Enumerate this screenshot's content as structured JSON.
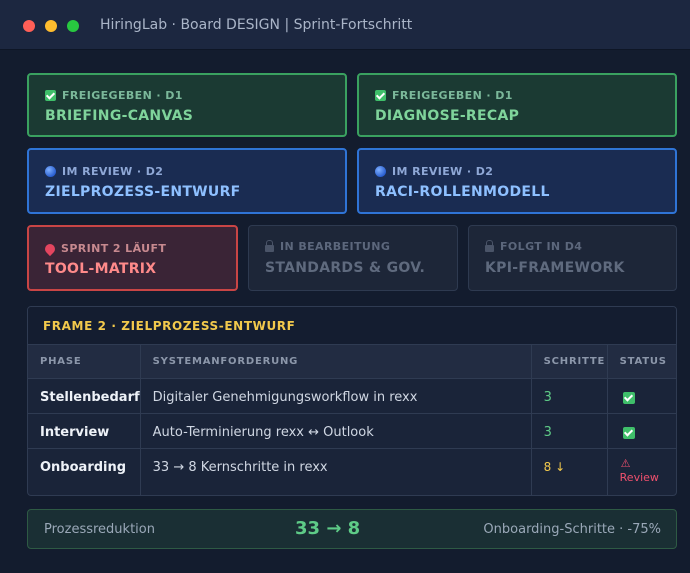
{
  "window": {
    "title": "HiringLab · Board DESIGN | Sprint-Fortschritt"
  },
  "colors": {
    "approved": "#3aa160",
    "review": "#2f74d6",
    "running": "#c94545",
    "locked": "#2e3a50",
    "accent": "#f2c94c"
  },
  "cards": [
    {
      "icon": "check-icon",
      "status": "FREIGEGEBEN · D1",
      "name": "BRIEFING-CANVAS"
    },
    {
      "icon": "check-icon",
      "status": "FREIGEGEBEN · D1",
      "name": "DIAGNOSE-RECAP"
    },
    {
      "icon": "globe-icon",
      "status": "IM REVIEW · D2",
      "name": "ZIELPROZESS-ENTWURF"
    },
    {
      "icon": "globe-icon",
      "status": "IM REVIEW · D2",
      "name": "RACI-ROLLENMODELL"
    },
    {
      "icon": "pin-icon",
      "status": "SPRINT 2 LÄUFT",
      "name": "TOOL-MATRIX"
    },
    {
      "icon": "lock-icon",
      "status": "IN BEARBEITUNG",
      "name": "STANDARDS & GOV."
    },
    {
      "icon": "lock-icon",
      "status": "FOLGT IN D4",
      "name": "KPI-FRAMEWORK"
    }
  ],
  "frame": {
    "title": "FRAME 2 · ZIELPROZESS-ENTWURF",
    "headers": [
      "PHASE",
      "SYSTEMANFORDERUNG",
      "SCHRITTE",
      "STATUS"
    ],
    "rows": [
      {
        "phase": "Stellenbedarf",
        "req": "Digitaler Genehmigungsworkflow in rexx",
        "steps": "3",
        "status": "check-icon"
      },
      {
        "phase": "Interview",
        "req": "Auto-Terminierung rexx ↔ Outlook",
        "steps": "3",
        "status": "check-icon"
      },
      {
        "phase": "Onboarding",
        "req": "33 → 8 Kernschritte in rexx",
        "steps": "8 ↓",
        "status_icon": "⚠",
        "status_text": "Review"
      }
    ]
  },
  "summary": {
    "label": "Prozessreduktion",
    "value": "33 → 8",
    "note": "Onboarding-Schritte · -75%"
  }
}
